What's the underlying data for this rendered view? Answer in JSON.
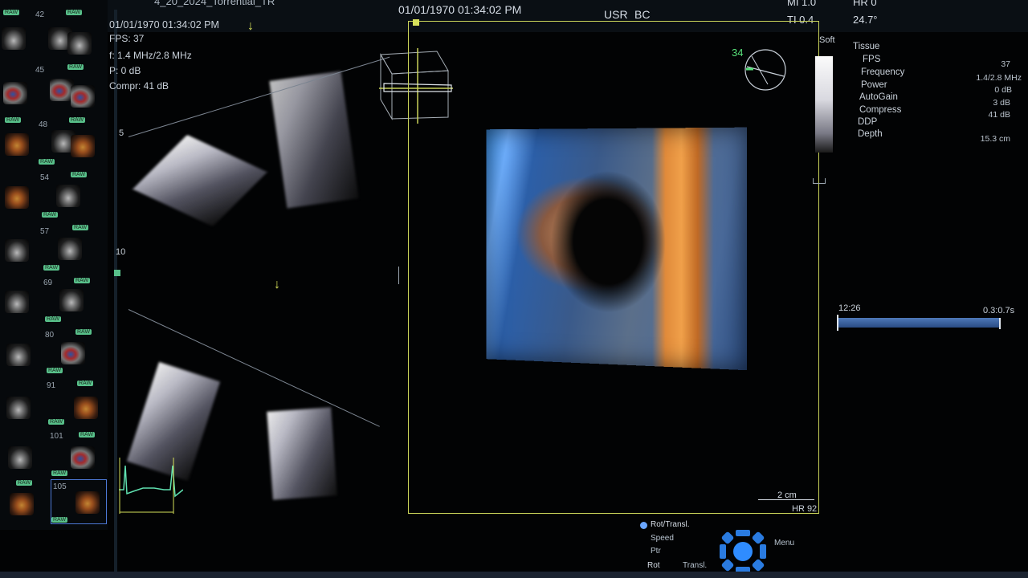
{
  "top": {
    "filename": "4_20_2024_Torrential_TR",
    "datetime": "01/01/1970 01:34:02 PM",
    "user": "USR",
    "user2": "BC",
    "mi": "MI 1.0",
    "ti": "TI 0.4",
    "hr": "HR 0",
    "temp": "24.7°"
  },
  "thumbnails": {
    "raw_label": "RAW",
    "frames": [
      "42",
      "45",
      "48",
      "54",
      "57",
      "69",
      "80",
      "91",
      "101",
      "105"
    ]
  },
  "view2d": {
    "datetime": "01/01/1970 01:34:02 PM",
    "fps": "FPS: 37",
    "freq": "f: 1.4 MHz/2.8 MHz",
    "power": "P: 0 dB",
    "compr": "Compr: 41 dB",
    "depth5": "5",
    "depth10": "10"
  },
  "view3d": {
    "angle": "34",
    "soft_label": "Soft",
    "scale": "2 cm",
    "hr": "HR 92"
  },
  "params": {
    "title": "Tissue",
    "rows": [
      {
        "label": "FPS",
        "value": "37"
      },
      {
        "label": "Frequency",
        "value": "1.4/2.8 MHz"
      },
      {
        "label": "Power",
        "value": "0 dB"
      },
      {
        "label": "AutoGain",
        "value": "3 dB"
      },
      {
        "label": "Compress",
        "value": "41 dB"
      },
      {
        "label": "DDP",
        "value": ""
      },
      {
        "label": "Depth",
        "value": "15.3 cm"
      }
    ]
  },
  "cine": {
    "time": "12:26",
    "range": "0.3:0.7s"
  },
  "controls": {
    "rot_transl": "Rot/Transl.",
    "speed": "Speed",
    "ptr": "Ptr",
    "rot": "Rot",
    "transl": "Transl.",
    "menu": "Menu"
  },
  "colors": {
    "frame": "#c9d35a",
    "accent": "#d7e05a",
    "raw_badge": "#58c08a",
    "trackball": "#2a7be0"
  }
}
